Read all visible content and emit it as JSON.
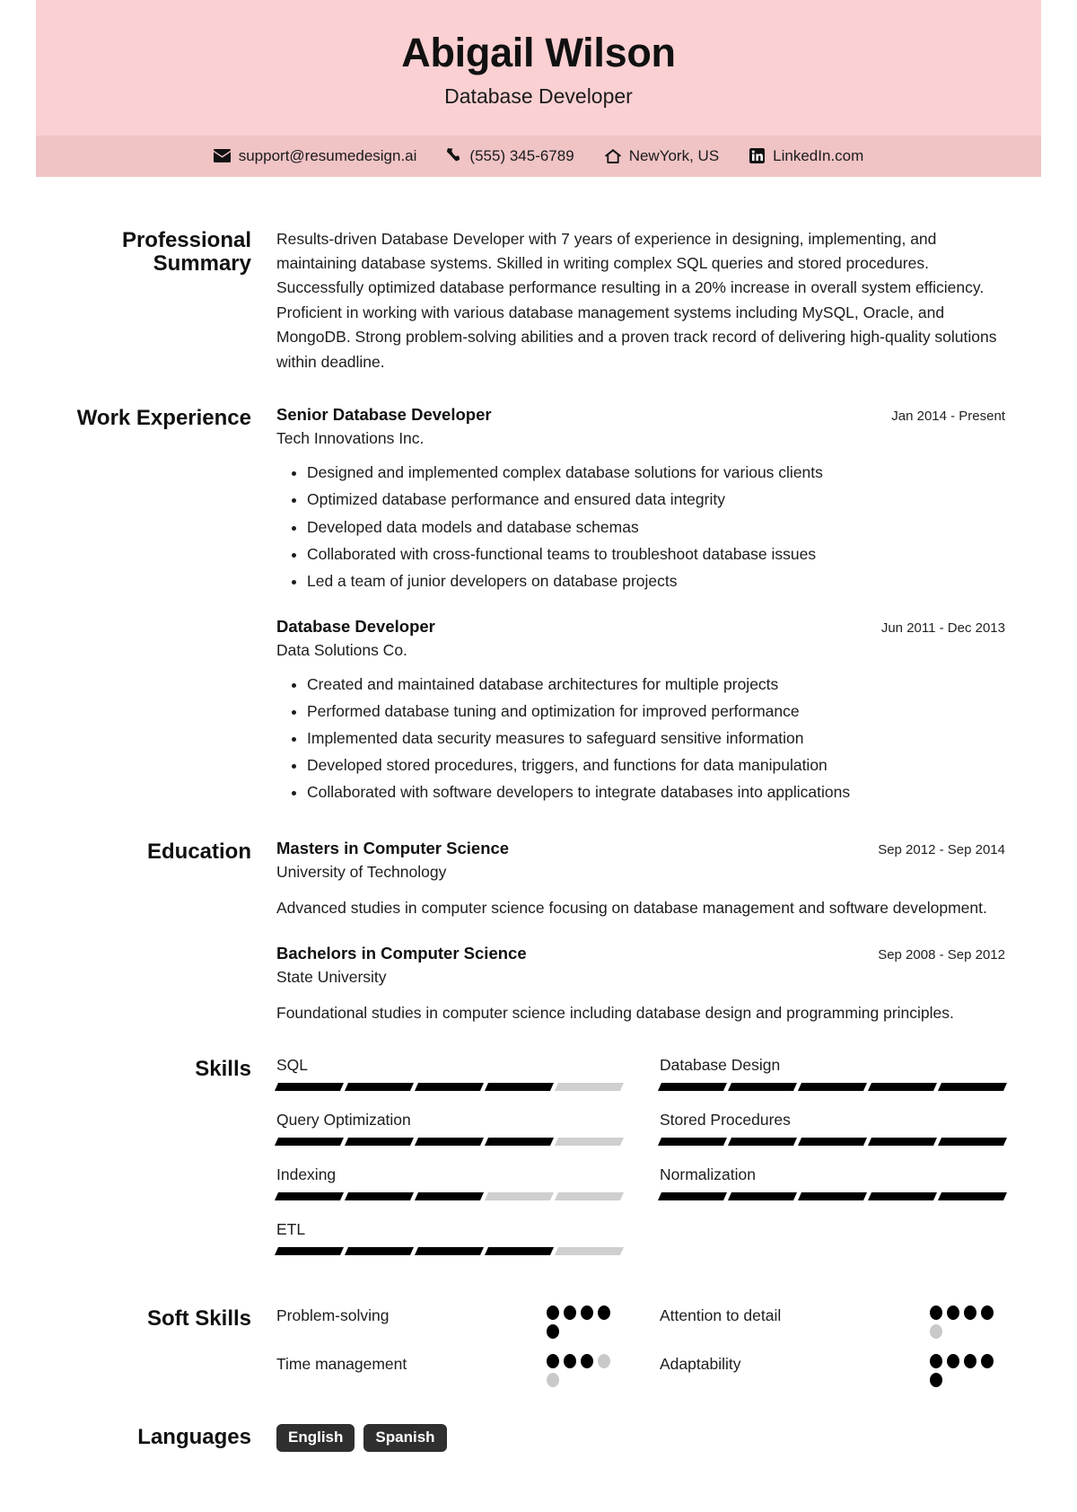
{
  "header": {
    "name": "Abigail Wilson",
    "title": "Database Developer",
    "band_color": "#fbd0d2",
    "contact_band_color": "#f0c3c5",
    "contacts": [
      {
        "icon": "envelope-icon",
        "value": "support@resumedesign.ai"
      },
      {
        "icon": "phone-icon",
        "value": "(555) 345-6789"
      },
      {
        "icon": "home-icon",
        "value": "NewYork, US"
      },
      {
        "icon": "linkedin-icon",
        "value": "LinkedIn.com"
      }
    ]
  },
  "summary": {
    "label": "Professional Summary",
    "text": "Results-driven Database Developer with 7 years of experience in designing, implementing, and maintaining database systems. Skilled in writing complex SQL queries and stored procedures. Successfully optimized database performance resulting in a 20% increase in overall system efficiency. Proficient in working with various database management systems including MySQL, Oracle, and MongoDB. Strong problem-solving abilities and a proven track record of delivering high-quality solutions within deadline."
  },
  "work": {
    "label": "Work Experience",
    "entries": [
      {
        "title": "Senior Database Developer",
        "org": "Tech Innovations Inc.",
        "date": "Jan 2014 - Present",
        "bullets": [
          "Designed and implemented complex database solutions for various clients",
          "Optimized database performance and ensured data integrity",
          "Developed data models and database schemas",
          "Collaborated with cross-functional teams to troubleshoot database issues",
          "Led a team of junior developers on database projects"
        ]
      },
      {
        "title": "Database Developer",
        "org": "Data Solutions Co.",
        "date": "Jun 2011 - Dec 2013",
        "bullets": [
          "Created and maintained database architectures for multiple projects",
          "Performed database tuning and optimization for improved performance",
          "Implemented data security measures to safeguard sensitive information",
          "Developed stored procedures, triggers, and functions for data manipulation",
          "Collaborated with software developers to integrate databases into applications"
        ]
      }
    ]
  },
  "education": {
    "label": "Education",
    "entries": [
      {
        "title": "Masters in Computer Science",
        "org": "University of Technology",
        "date": "Sep 2012 - Sep 2014",
        "desc": "Advanced studies in computer science focusing on database management and software development."
      },
      {
        "title": "Bachelors in Computer Science",
        "org": "State University",
        "date": "Sep 2008 - Sep 2012",
        "desc": "Foundational studies in computer science including database design and programming principles."
      }
    ]
  },
  "skills": {
    "label": "Skills",
    "max": 5,
    "items": [
      {
        "name": "SQL",
        "level": 4
      },
      {
        "name": "Database Design",
        "level": 5
      },
      {
        "name": "Query Optimization",
        "level": 4
      },
      {
        "name": "Stored Procedures",
        "level": 5
      },
      {
        "name": "Indexing",
        "level": 3
      },
      {
        "name": "Normalization",
        "level": 5
      },
      {
        "name": "ETL",
        "level": 4
      }
    ]
  },
  "soft_skills": {
    "label": "Soft Skills",
    "max": 5,
    "items": [
      {
        "name": "Problem-solving",
        "level": 5
      },
      {
        "name": "Attention to detail",
        "level": 4
      },
      {
        "name": "Time management",
        "level": 3
      },
      {
        "name": "Adaptability",
        "level": 5
      }
    ]
  },
  "languages": {
    "label": "Languages",
    "items": [
      "English",
      "Spanish"
    ]
  }
}
